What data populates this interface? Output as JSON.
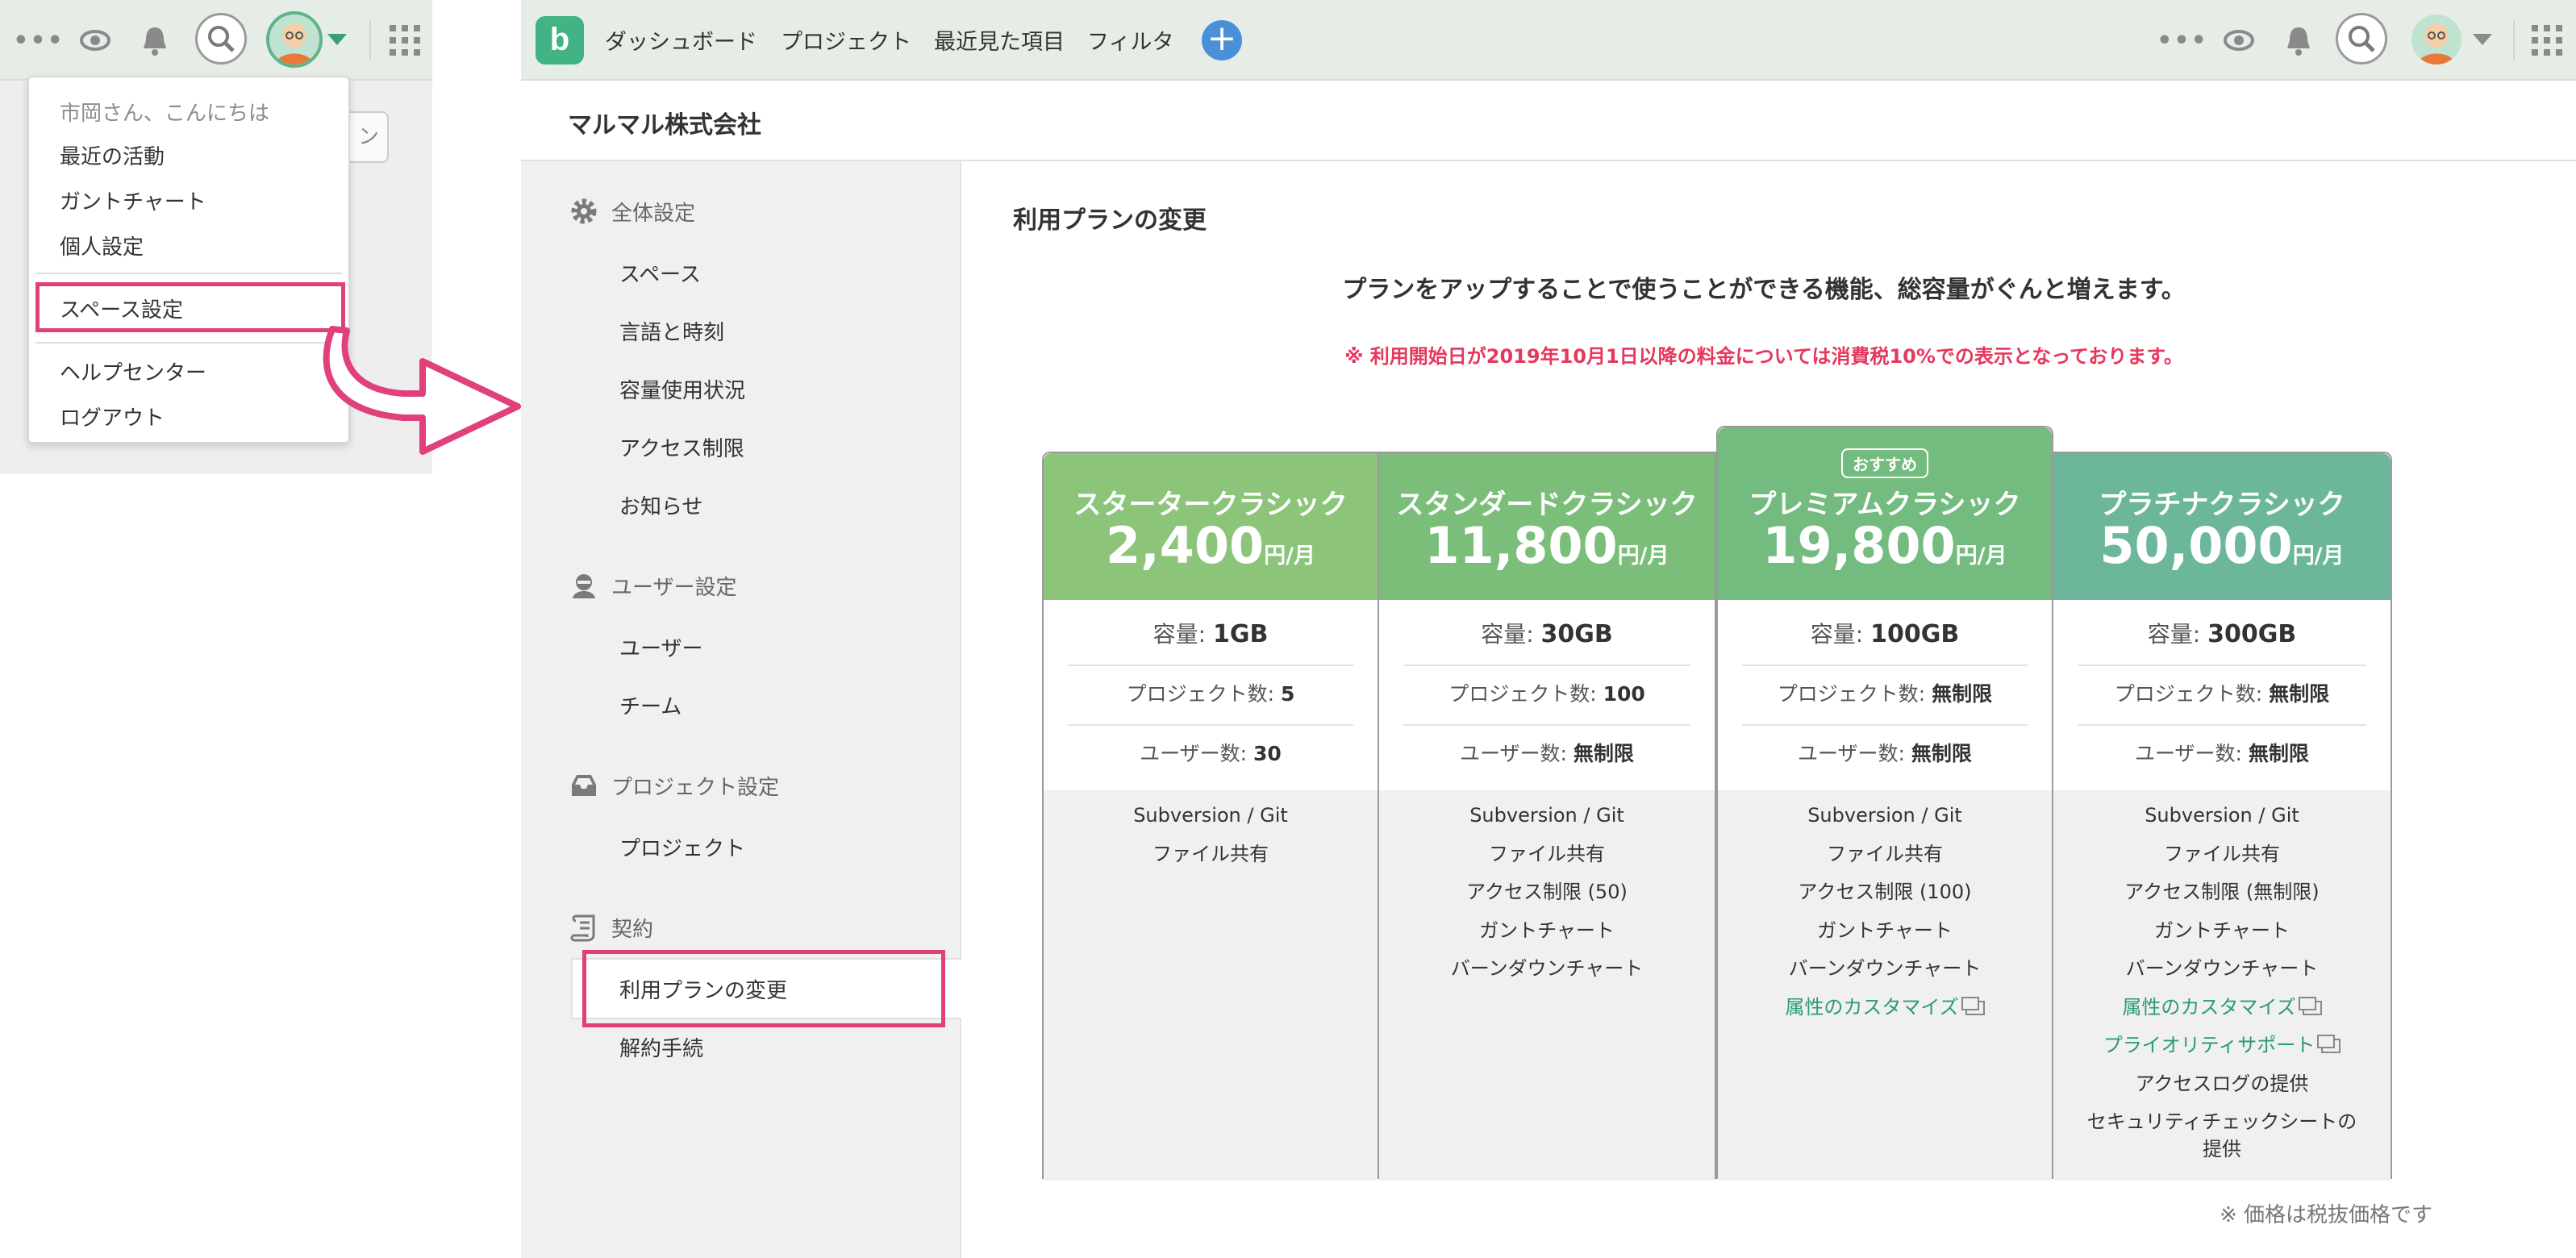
{
  "left_window": {
    "toolbar_icons": [
      "more-dots-icon",
      "eye-icon",
      "bell-icon",
      "search-icon",
      "avatar",
      "chevron-down-icon",
      "apps-grid-icon"
    ],
    "dots": "•••",
    "behind_button_text": "ン",
    "menu": {
      "greeting": "市岡さん、こんにちは",
      "items": [
        "最近の活動",
        "ガントチャート",
        "個人設定"
      ],
      "highlighted_item": "スペース設定",
      "footer_items": [
        "ヘルプセンター",
        "ログアウト"
      ]
    }
  },
  "main_window": {
    "logo_letter": "b",
    "nav": [
      "ダッシュボード",
      "プロジェクト",
      "最近見た項目",
      "フィルタ"
    ],
    "plus": "+",
    "dots": "•••",
    "company": "マルマル株式会社",
    "sidebar": {
      "sections": [
        {
          "title": "全体設定",
          "icon": "gear-icon",
          "items": [
            "スペース",
            "言語と時刻",
            "容量使用状況",
            "アクセス制限",
            "お知らせ"
          ]
        },
        {
          "title": "ユーザー設定",
          "icon": "user-icon",
          "items": [
            "ユーザー",
            "チーム"
          ]
        },
        {
          "title": "プロジェクト設定",
          "icon": "inbox-icon",
          "items": [
            "プロジェクト"
          ]
        },
        {
          "title": "契約",
          "icon": "scroll-icon",
          "items": [
            "利用プランの変更",
            "解約手続"
          ]
        }
      ],
      "active_item": "利用プランの変更"
    },
    "content": {
      "title": "利用プランの変更",
      "headline": "プランをアップすることで使うことができる機能、総容量がぐんと増えます。",
      "notice": "※ 利用開始日が2019年10月1日以降の料金については消費税10%での表示となっております。",
      "tax_note": "※ 価格は税抜価格です",
      "price_unit": "円/月",
      "labels": {
        "storage": "容量: ",
        "projects": "プロジェクト数: ",
        "users": "ユーザー数: "
      },
      "plans": [
        {
          "name": "スタータークラシック",
          "price": "2,400",
          "color": "#8cc47a",
          "badge": "",
          "storage": "1GB",
          "projects": "5",
          "users": "30",
          "features": [
            {
              "text": "Subversion / Git"
            },
            {
              "text": "ファイル共有"
            }
          ]
        },
        {
          "name": "スタンダードクラシック",
          "price": "11,800",
          "color": "#7bbe7a",
          "badge": "",
          "storage": "30GB",
          "projects": "100",
          "users": "無制限",
          "features": [
            {
              "text": "Subversion / Git"
            },
            {
              "text": "ファイル共有"
            },
            {
              "text": "アクセス制限 (50)"
            },
            {
              "text": "ガントチャート"
            },
            {
              "text": "バーンダウンチャート"
            }
          ]
        },
        {
          "name": "プレミアムクラシック",
          "price": "19,800",
          "color": "#74bb80",
          "badge": "おすすめ",
          "storage": "100GB",
          "projects": "無制限",
          "users": "無制限",
          "features": [
            {
              "text": "Subversion / Git"
            },
            {
              "text": "ファイル共有"
            },
            {
              "text": "アクセス制限 (100)"
            },
            {
              "text": "ガントチャート"
            },
            {
              "text": "バーンダウンチャート"
            },
            {
              "text": "属性のカスタマイズ",
              "link": true
            }
          ]
        },
        {
          "name": "プラチナクラシック",
          "price": "50,000",
          "color": "#6cb79a",
          "badge": "",
          "storage": "300GB",
          "projects": "無制限",
          "users": "無制限",
          "features": [
            {
              "text": "Subversion / Git"
            },
            {
              "text": "ファイル共有"
            },
            {
              "text": "アクセス制限 (無制限)"
            },
            {
              "text": "ガントチャート"
            },
            {
              "text": "バーンダウンチャート"
            },
            {
              "text": "属性のカスタマイズ",
              "link": true
            },
            {
              "text": "プライオリティサポート",
              "link": true
            },
            {
              "text": "アクセスログの提供"
            },
            {
              "text": "セキュリティチェックシートの提供"
            }
          ]
        }
      ]
    }
  },
  "colors": {
    "highlight": "#e0407c",
    "logo": "#42b385",
    "plus": "#4a90d9",
    "notice": "#e6375c",
    "link": "#2a9a7a"
  }
}
